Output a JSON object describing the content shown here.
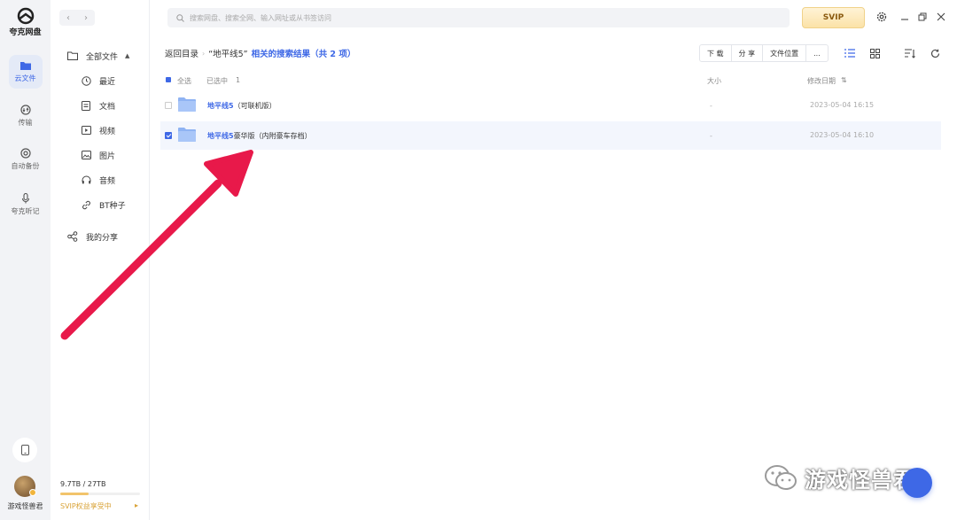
{
  "app": {
    "name": "夸克网盘"
  },
  "rail": {
    "items": [
      {
        "label": "云文件",
        "icon": "cloud-file-icon",
        "active": true
      },
      {
        "label": "传输",
        "icon": "transfer-icon"
      },
      {
        "label": "自动备份",
        "icon": "backup-icon"
      },
      {
        "label": "夸克听记",
        "icon": "mic-icon"
      }
    ],
    "user_name": "游戏怪兽君"
  },
  "sidebar": {
    "all_files": "全部文件",
    "items": [
      {
        "label": "最近",
        "icon": "clock-icon"
      },
      {
        "label": "文档",
        "icon": "document-icon"
      },
      {
        "label": "视频",
        "icon": "video-icon"
      },
      {
        "label": "图片",
        "icon": "image-icon"
      },
      {
        "label": "音频",
        "icon": "headphones-icon"
      },
      {
        "label": "BT种子",
        "icon": "link-icon"
      }
    ],
    "my_share": "我的分享",
    "storage": {
      "text": "9.7TB / 27TB",
      "used_fraction": 0.36
    },
    "svip_tip": "SVIP权益享受中"
  },
  "topbar": {
    "search_placeholder": "搜索网盘、搜索全网、输入网址或从书签访问",
    "svip": "SVIP"
  },
  "header": {
    "back": "返回目录",
    "query": "“地平线5”",
    "result": "相关的搜索结果（共 2 项）"
  },
  "toolbar": {
    "download": "下 载",
    "share": "分 享",
    "location": "文件位置",
    "more": "..."
  },
  "table": {
    "select_all": "全选",
    "selected": "已选中",
    "selected_count": "1",
    "col_size": "大小",
    "col_date": "修改日期",
    "rows": [
      {
        "name_hl": "地平线5",
        "name_rest": "（可联机版）",
        "size": "-",
        "date": "2023-05-04 16:15",
        "checked": false
      },
      {
        "name_hl": "地平线5",
        "name_rest": "豪华版（内附豪车存档）",
        "size": "-",
        "date": "2023-05-04 16:10",
        "checked": true
      }
    ]
  },
  "watermark": {
    "text": "游戏怪兽君"
  },
  "colors": {
    "accent": "#3e68e6",
    "arrow": "#e8194a",
    "svip_gold": "#f2c46b"
  }
}
